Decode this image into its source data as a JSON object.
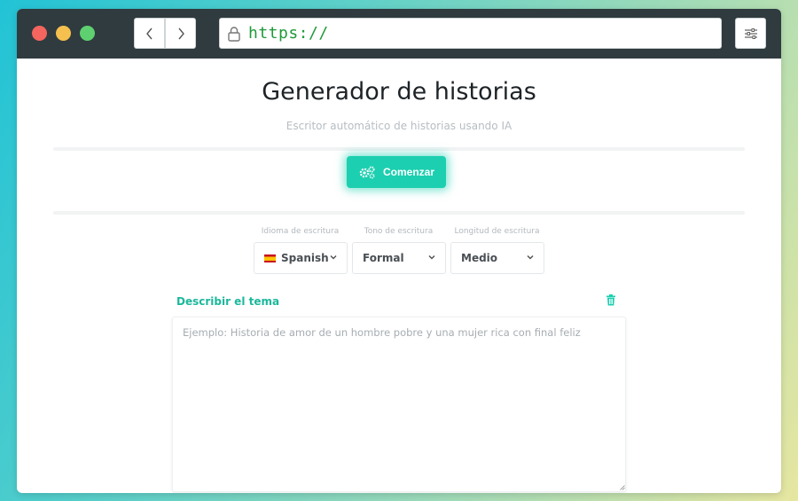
{
  "browser": {
    "url": "https://"
  },
  "page": {
    "title": "Generador de historias",
    "subtitle": "Escritor automático de historias usando IA",
    "start_button_label": "Comenzar"
  },
  "options": {
    "language": {
      "label": "Idioma de escritura",
      "value": "Spanish"
    },
    "tone": {
      "label": "Tono de escritura",
      "value": "Formal"
    },
    "length": {
      "label": "Longitud de escritura",
      "value": "Medio"
    }
  },
  "topic": {
    "label": "Describir el tema",
    "value": "",
    "placeholder": "Ejemplo: Historia de amor de un hombre pobre y una mujer rica con final feliz"
  },
  "colors": {
    "accent": "#1ccfb0",
    "titlebar": "#2f3b3f",
    "url_text": "#1f9a3a"
  },
  "icons": {
    "back": "chevron-left-icon",
    "forward": "chevron-right-icon",
    "lock": "lock-icon",
    "settings": "sliders-icon",
    "start": "gears-icon",
    "language_flag": "spain-flag-icon",
    "dropdown": "chevron-down-icon",
    "clear": "trash-icon"
  }
}
